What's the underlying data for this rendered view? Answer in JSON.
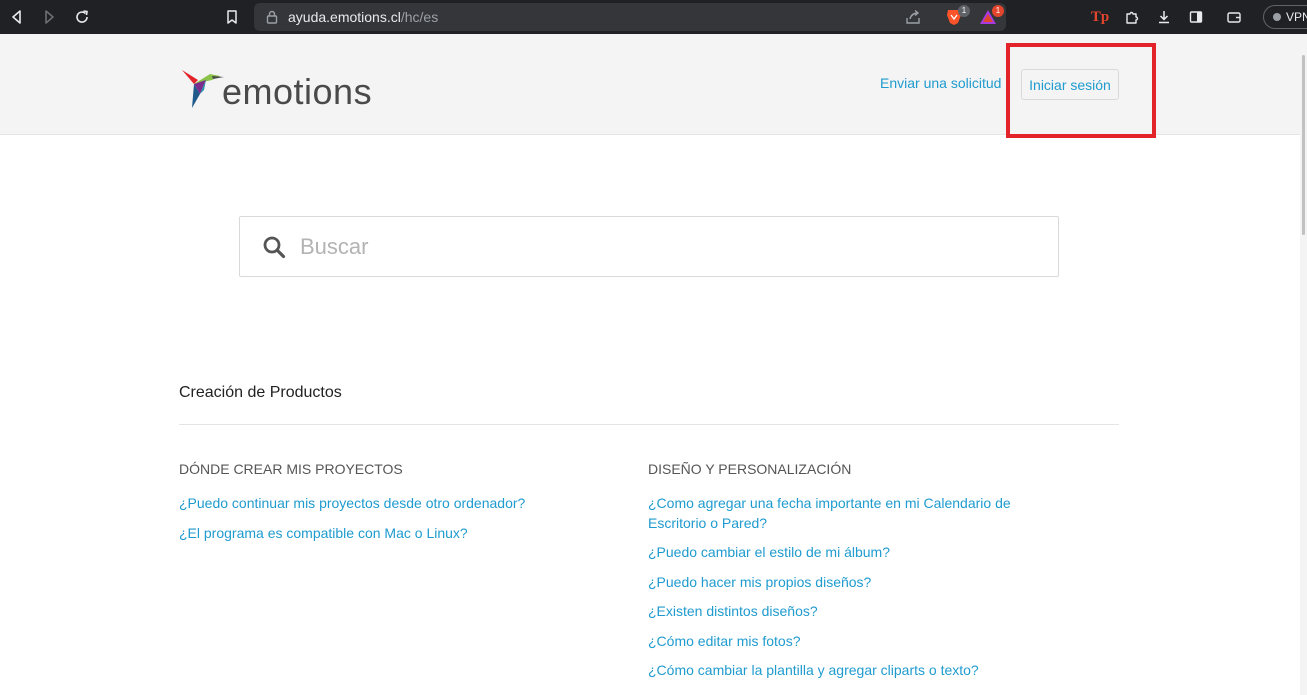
{
  "browser": {
    "url_host": "ayuda.emotions.cl",
    "url_path": "/hc/es",
    "brave_badge": "1",
    "rewards_badge": "1",
    "tp_label": "Tp",
    "vpn_label": "VPN"
  },
  "header": {
    "logo_text": "emotions",
    "submit_request_label": "Enviar una solicitud",
    "sign_in_label": "Iniciar sesión"
  },
  "search": {
    "placeholder": "Buscar"
  },
  "category": {
    "title": "Creación de Productos",
    "sections": [
      {
        "title": "DÓNDE CREAR MIS PROYECTOS",
        "articles": [
          "¿Puedo continuar mis proyectos desde otro ordenador?",
          "¿El programa es compatible con Mac o Linux?"
        ]
      },
      {
        "title": "DISEÑO Y PERSONALIZACIÓN",
        "articles": [
          "¿Como agregar una fecha importante en mi Calendario de Escritorio o Pared?",
          "¿Puedo cambiar el estilo de mi álbum?",
          "¿Puedo hacer mis propios diseños?",
          "¿Existen distintos diseños?",
          "¿Cómo editar mis fotos?",
          "¿Cómo cambiar la plantilla y agregar cliparts o texto?"
        ]
      }
    ]
  },
  "colors": {
    "link": "#1f9bcf",
    "highlight": "#e2242a",
    "header_bg": "#f4f4f4"
  }
}
